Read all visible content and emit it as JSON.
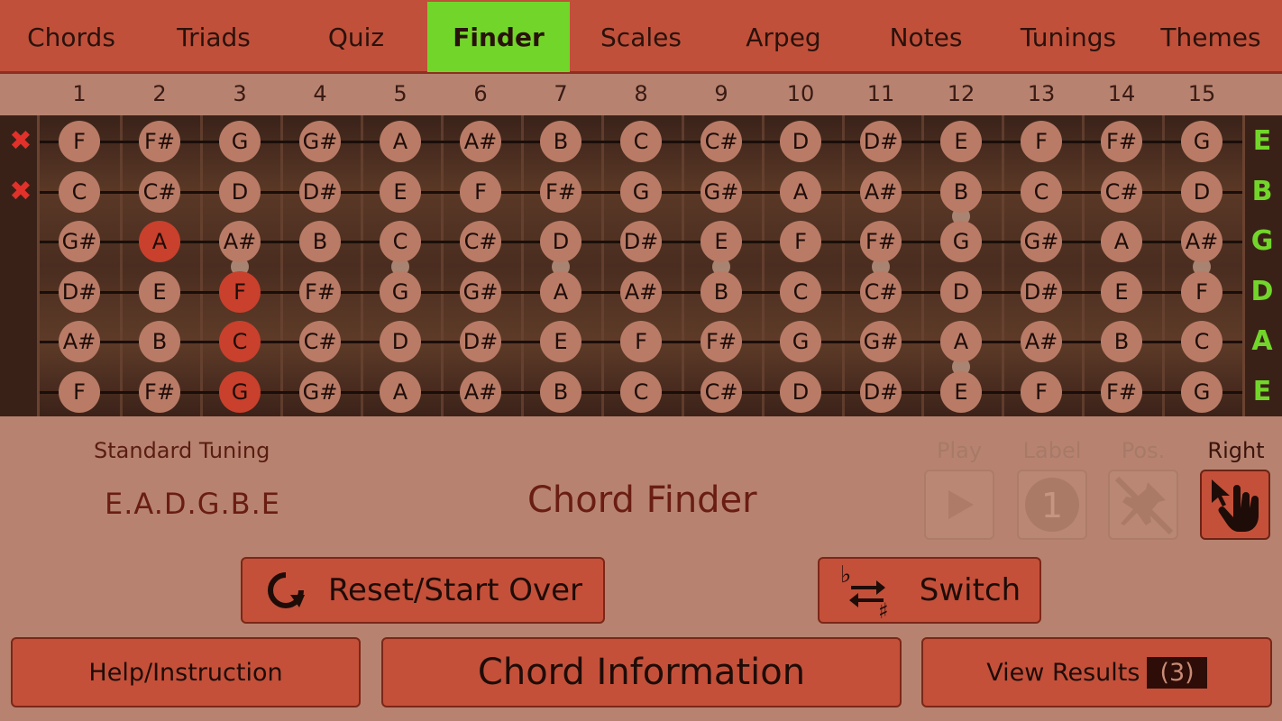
{
  "tabs": [
    {
      "label": "Chords",
      "active": false
    },
    {
      "label": "Triads",
      "active": false
    },
    {
      "label": "Quiz",
      "active": false
    },
    {
      "label": "Finder",
      "active": true
    },
    {
      "label": "Scales",
      "active": false
    },
    {
      "label": "Arpeg",
      "active": false
    },
    {
      "label": "Notes",
      "active": false
    },
    {
      "label": "Tunings",
      "active": false
    },
    {
      "label": "Themes",
      "active": false
    }
  ],
  "fret_numbers": [
    "1",
    "2",
    "3",
    "4",
    "5",
    "6",
    "7",
    "8",
    "9",
    "10",
    "11",
    "12",
    "13",
    "14",
    "15"
  ],
  "strings": [
    {
      "name": "E",
      "muted": true,
      "notes": [
        "F",
        "F#",
        "G",
        "G#",
        "A",
        "A#",
        "B",
        "C",
        "C#",
        "D",
        "D#",
        "E",
        "F",
        "F#",
        "G"
      ],
      "selected_fret": null
    },
    {
      "name": "B",
      "muted": true,
      "notes": [
        "C",
        "C#",
        "D",
        "D#",
        "E",
        "F",
        "F#",
        "G",
        "G#",
        "A",
        "A#",
        "B",
        "C",
        "C#",
        "D"
      ],
      "selected_fret": null
    },
    {
      "name": "G",
      "muted": false,
      "notes": [
        "G#",
        "A",
        "A#",
        "B",
        "C",
        "C#",
        "D",
        "D#",
        "E",
        "F",
        "F#",
        "G",
        "G#",
        "A",
        "A#"
      ],
      "selected_fret": 2
    },
    {
      "name": "D",
      "muted": false,
      "notes": [
        "D#",
        "E",
        "F",
        "F#",
        "G",
        "G#",
        "A",
        "A#",
        "B",
        "C",
        "C#",
        "D",
        "D#",
        "E",
        "F"
      ],
      "selected_fret": 3
    },
    {
      "name": "A",
      "muted": false,
      "notes": [
        "A#",
        "B",
        "C",
        "C#",
        "D",
        "D#",
        "E",
        "F",
        "F#",
        "G",
        "G#",
        "A",
        "A#",
        "B",
        "C"
      ],
      "selected_fret": 3
    },
    {
      "name": "E",
      "muted": false,
      "notes": [
        "F",
        "F#",
        "G",
        "G#",
        "A",
        "A#",
        "B",
        "C",
        "C#",
        "D",
        "D#",
        "E",
        "F",
        "F#",
        "G"
      ],
      "selected_fret": 3
    }
  ],
  "mute_icon": "x-mark-icon",
  "tuning": {
    "label": "Standard Tuning",
    "value": "E.A.D.G.B.E"
  },
  "mode_title": "Chord Finder",
  "controls": {
    "play": {
      "label": "Play",
      "icon": "play-icon",
      "enabled": false
    },
    "label": {
      "label": "Label",
      "icon": "number-one-icon",
      "enabled": false
    },
    "pos": {
      "label": "Pos.",
      "icon": "pin-off-icon",
      "enabled": false
    },
    "hand": {
      "label": "Right",
      "icon": "hand-pointer-icon",
      "enabled": true
    }
  },
  "buttons": {
    "reset": {
      "label": "Reset/Start Over",
      "icon": "refresh-icon"
    },
    "switch": {
      "label": "Switch",
      "icon": "flat-sharp-switch-icon"
    },
    "help": {
      "label": "Help/Instruction"
    },
    "info": {
      "label": "Chord Information"
    },
    "results": {
      "label": "View Results",
      "count": "(3)"
    }
  },
  "colors": {
    "tab_bar": "#c0503a",
    "active_tab": "#72d62a",
    "background": "#b78370",
    "selected_note": "#c9402c",
    "note": "#b97b66",
    "mute_x": "#e2312a",
    "string_name": "#72d62a"
  }
}
